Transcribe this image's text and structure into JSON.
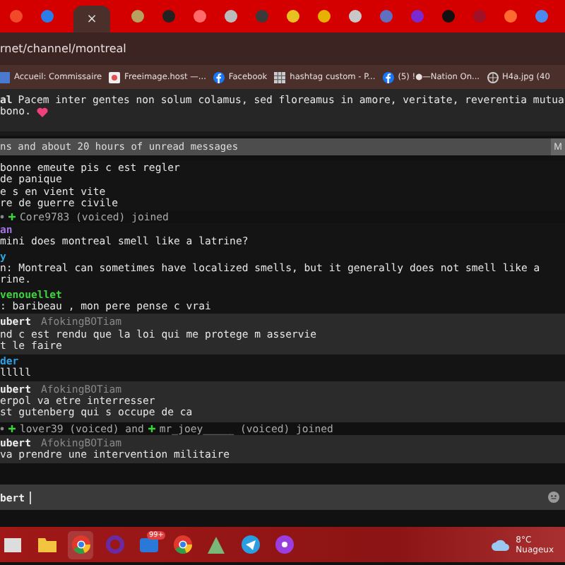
{
  "tabs": [
    {
      "selected": false,
      "color": "#f04a2a"
    },
    {
      "selected": false,
      "color": "#2a7de8"
    },
    {
      "selected": true,
      "close": "×"
    },
    {
      "selected": false,
      "color": "#b8a060"
    },
    {
      "selected": false,
      "color": "#222222"
    },
    {
      "selected": false,
      "color": "#ff6a6a"
    },
    {
      "selected": false,
      "color": "#bbbbbb"
    },
    {
      "selected": false,
      "color": "#3a3a3a"
    },
    {
      "selected": false,
      "color": "#e8c020"
    },
    {
      "selected": false,
      "color": "#e8b000"
    },
    {
      "selected": false,
      "color": "#c8c8c8"
    },
    {
      "selected": false,
      "color": "#6070c0"
    },
    {
      "selected": false,
      "color": "#7a2ad0"
    },
    {
      "selected": false,
      "color": "#111111"
    },
    {
      "selected": false,
      "color": "#a01028"
    },
    {
      "selected": false,
      "color": "#ff6a30"
    },
    {
      "selected": false,
      "color": "#4a8af0"
    }
  ],
  "address": "rnet/channel/montreal",
  "bookmarks": [
    {
      "label": "Accueil: Commissaire",
      "kind": "page"
    },
    {
      "label": "Freeimage.host —...",
      "kind": "image"
    },
    {
      "label": "Facebook",
      "kind": "facebook"
    },
    {
      "label": "hashtag custom - P...",
      "kind": "grid"
    },
    {
      "label": "(5) !●—Nation On...",
      "kind": "facebook"
    },
    {
      "label": "H4a.jpg (40",
      "kind": "globe"
    }
  ],
  "topic": {
    "nick": "al",
    "lines": [
      "Pacem inter gentes non solum colamus, sed floreamus in amore, veritate, reverentia mutua",
      "bono."
    ]
  },
  "unread_bar": {
    "text": "ns and about 20 hours of unread messages",
    "button": "M"
  },
  "messages": [
    {
      "kind": "message",
      "highlighted": false,
      "lines": [
        "bonne emeute pis c est regler",
        "de panique",
        "e s en vient vite",
        "re de guerre civile"
      ]
    },
    {
      "kind": "join",
      "segments": [
        "Core9783 (voiced) joined"
      ]
    },
    {
      "kind": "message",
      "nick": "an",
      "color": "#a274e0",
      "highlighted": false,
      "lines": [
        "mini does montreal smell like a latrine?"
      ]
    },
    {
      "kind": "message",
      "nick": "y",
      "color": "#2ea8e6",
      "highlighted": false,
      "lines": [
        "n: Montreal can sometimes have localized smells, but it generally does not smell like a",
        "rine."
      ]
    },
    {
      "kind": "message",
      "nick": "venouellet",
      "color": "#3ed23e",
      "highlighted": false,
      "lines": [
        ": baribeau , mon pere pense c vrai"
      ]
    },
    {
      "kind": "message",
      "nick": "ubert",
      "tag": "AfokingBOTiam",
      "color": "#eeeeee",
      "highlighted": true,
      "lines": [
        "nd c est rendu que la loi qui me protege m asservie",
        "t le faire"
      ]
    },
    {
      "kind": "message",
      "nick": "der",
      "color": "#2ea0e6",
      "highlighted": false,
      "lines": [
        "lllll"
      ]
    },
    {
      "kind": "message",
      "nick": "ubert",
      "tag": "AfokingBOTiam",
      "color": "#eeeeee",
      "highlighted": true,
      "lines": [
        "erpol va etre interresser",
        "st gutenberg qui s occupe de ca"
      ]
    },
    {
      "kind": "join",
      "segments": [
        "lover39 (voiced) and",
        "mr_joey_____ (voiced) joined"
      ]
    },
    {
      "kind": "message",
      "nick": "ubert",
      "tag": "AfokingBOTiam",
      "color": "#eeeeee",
      "highlighted": true,
      "lines": [
        "va prendre une intervention militaire"
      ]
    }
  ],
  "composer": {
    "nick": "bert"
  },
  "taskbar": {
    "apps": [
      {
        "kind": "window"
      },
      {
        "kind": "folder"
      },
      {
        "kind": "chrome",
        "selected": true
      },
      {
        "kind": "ring",
        "selected": false
      },
      {
        "kind": "mail",
        "badge": "99+",
        "selected": false
      },
      {
        "kind": "chrome",
        "selected": false
      },
      {
        "kind": "triangle",
        "selected": false
      },
      {
        "kind": "plane",
        "selected": false
      },
      {
        "kind": "podcast",
        "selected": false
      }
    ],
    "weather": {
      "temp": "8°C",
      "condition": "Nuageux"
    }
  }
}
